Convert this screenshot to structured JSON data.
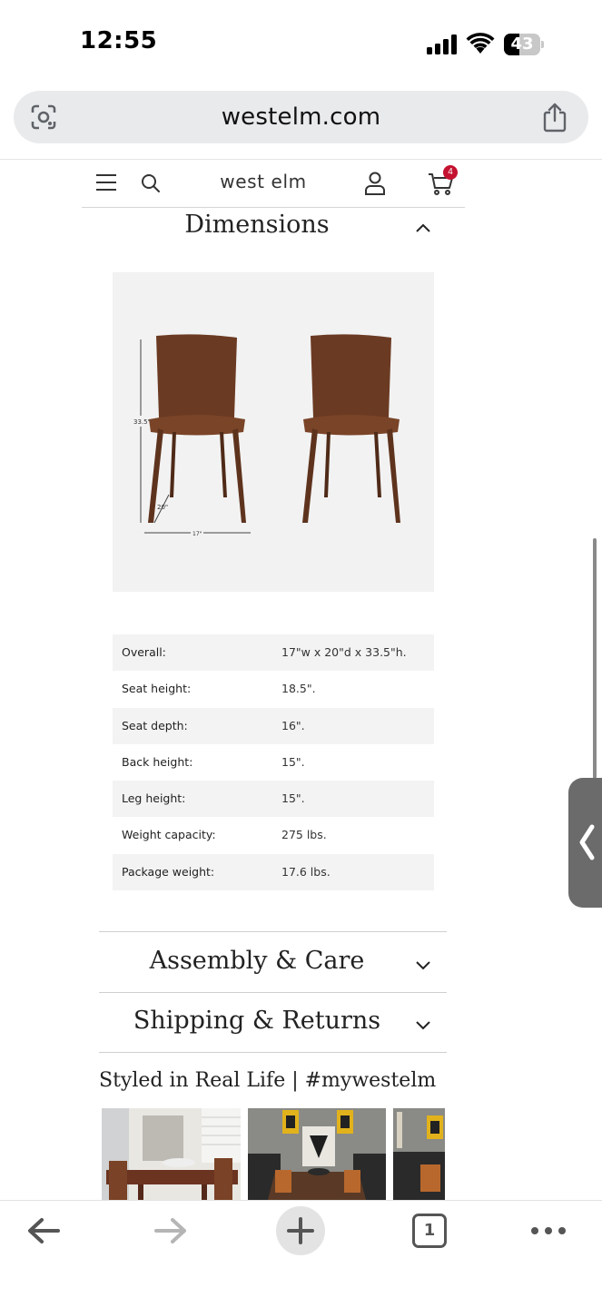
{
  "status_bar": {
    "time": "12:55",
    "battery_level": "43"
  },
  "browser": {
    "url": "westelm.com",
    "tab_count": "1"
  },
  "site_header": {
    "logo": "west elm",
    "cart_count": "4"
  },
  "dimensions_section": {
    "title": "Dimensions",
    "expanded": true,
    "image_labels": {
      "height": "33.5\"",
      "depth": "20\"",
      "width": "17\""
    },
    "rows": [
      {
        "label": "Overall:",
        "value": "17\"w x 20\"d x 33.5\"h."
      },
      {
        "label": "Seat height:",
        "value": "18.5\"."
      },
      {
        "label": "Seat depth:",
        "value": "16\"."
      },
      {
        "label": "Back height:",
        "value": "15\"."
      },
      {
        "label": "Leg height:",
        "value": "15\"."
      },
      {
        "label": "Weight capacity:",
        "value": "275 lbs."
      },
      {
        "label": "Package weight:",
        "value": "17.6 lbs."
      }
    ]
  },
  "accordions": {
    "assembly_care": "Assembly & Care",
    "shipping_returns": "Shipping & Returns"
  },
  "styled_section": {
    "title": "Styled in Real Life | #mywestelm"
  },
  "colors": {
    "chair_wood": "#6b3a22",
    "badge_red": "#c41230",
    "url_bar_bg": "#e9eaec"
  },
  "icons": [
    "google-lens-icon",
    "share-icon",
    "hamburger-menu-icon",
    "search-icon",
    "account-icon",
    "cart-icon",
    "chevron-up-icon",
    "chevron-down-icon",
    "back-arrow-icon",
    "forward-arrow-icon",
    "plus-icon",
    "tabs-icon",
    "more-dots-icon",
    "chevron-left-icon"
  ]
}
